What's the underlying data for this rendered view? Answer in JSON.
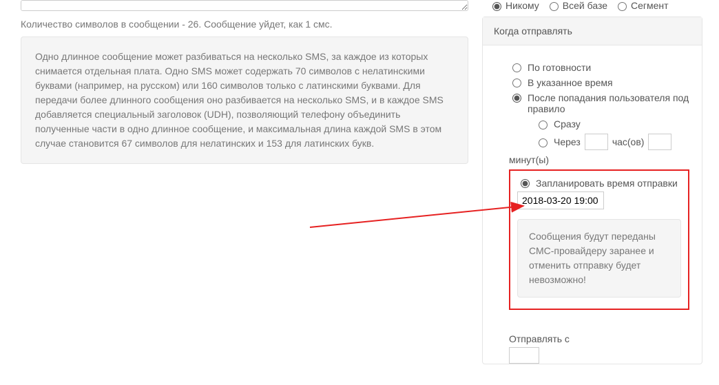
{
  "left": {
    "textarea_value": "",
    "char_count_text": "Количество символов в сообщении - 26. Сообщение уйдет, как 1 смс.",
    "info_text": "Одно длинное сообщение может разбиваться на несколько SMS, за каждое из которых снимается отдельная плата. Одно SMS может содержать 70 символов с нелатинскими буквами (например, на русском) или 160 символов только с латинскими буквами. Для передачи более длинного сообщения оно разбивается на несколько SMS, и в каждое SMS добавляется специальный заголовок (UDH), позволяющий телефону объединить полученные части в одно длинное сообщение, и максимальная длина каждой SMS в этом случае становится 67 символов для нелатинских и 153 для латинских букв."
  },
  "top_radios": {
    "nobody": "Никому",
    "all_base": "Всей базе",
    "segment": "Сегмент"
  },
  "panel": {
    "header": "Когда отправлять",
    "ready": "По готовности",
    "at_time": "В указанное время",
    "after_rule": "После попадания пользователя под правило",
    "immediate": "Сразу",
    "after_label_1": "Через",
    "after_label_2": "час(ов)",
    "after_label_3": "минут(ы)",
    "hours_value": "",
    "minutes_value": "",
    "schedule_label": "Запланировать время отправки",
    "schedule_value": "2018-03-20 19:00",
    "warning_text": "Сообщения будут переданы СМС-провайдеру заранее и отменить отправку будет невозможно!",
    "send_from_label": "Отправлять с",
    "send_from_value": ""
  },
  "colors": {
    "highlight": "#e62121"
  }
}
